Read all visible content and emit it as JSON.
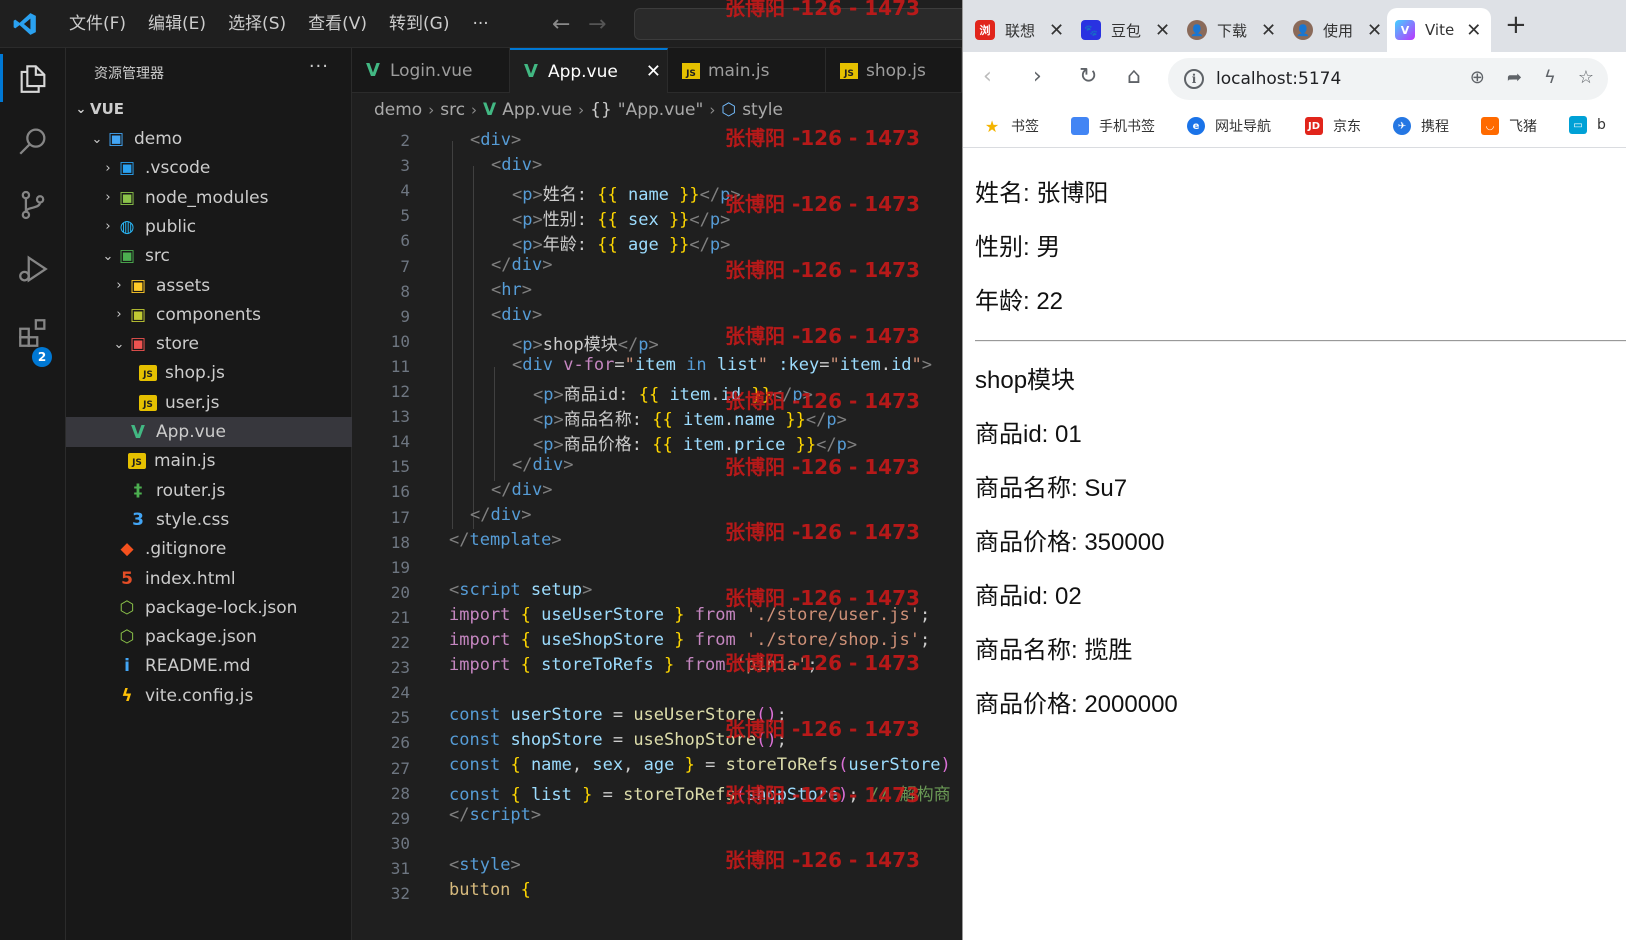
{
  "vscode": {
    "menus": [
      "文件(F)",
      "编辑(E)",
      "选择(S)",
      "查看(V)",
      "转到(G)"
    ],
    "menu_more": "···",
    "nav_back": "←",
    "nav_forward": "→",
    "badge_count": "2",
    "explorer": {
      "title": "资源管理器",
      "more": "···",
      "root": "VUE",
      "items": [
        {
          "label": "demo",
          "chev": "⌄",
          "icon": "folder-icon",
          "indent": 0
        },
        {
          "label": ".vscode",
          "chev": "›",
          "icon": "folder-vscode-icon",
          "indent": 1
        },
        {
          "label": "node_modules",
          "chev": "›",
          "icon": "folder-node-icon",
          "indent": 1
        },
        {
          "label": "public",
          "chev": "›",
          "icon": "folder-public-icon",
          "indent": 1
        },
        {
          "label": "src",
          "chev": "⌄",
          "icon": "folder-src-icon",
          "indent": 1
        },
        {
          "label": "assets",
          "chev": "›",
          "icon": "folder-assets-icon",
          "indent": 2
        },
        {
          "label": "components",
          "chev": "›",
          "icon": "folder-components-icon",
          "indent": 2
        },
        {
          "label": "store",
          "chev": "⌄",
          "icon": "folder-store-icon",
          "indent": 2
        },
        {
          "label": "shop.js",
          "chev": "",
          "icon": "js-file-icon",
          "indent": 3
        },
        {
          "label": "user.js",
          "chev": "",
          "icon": "js-file-icon",
          "indent": 3
        },
        {
          "label": "App.vue",
          "chev": "",
          "icon": "vue-file-icon",
          "indent": 2,
          "selected": true
        },
        {
          "label": "main.js",
          "chev": "",
          "icon": "js-file-icon",
          "indent": 2
        },
        {
          "label": "router.js",
          "chev": "",
          "icon": "router-file-icon",
          "indent": 2
        },
        {
          "label": "style.css",
          "chev": "",
          "icon": "css-file-icon",
          "indent": 2
        },
        {
          "label": ".gitignore",
          "chev": "",
          "icon": "git-file-icon",
          "indent": 1
        },
        {
          "label": "index.html",
          "chev": "",
          "icon": "html-file-icon",
          "indent": 1
        },
        {
          "label": "package-lock.json",
          "chev": "",
          "icon": "node-json-icon",
          "indent": 1
        },
        {
          "label": "package.json",
          "chev": "",
          "icon": "node-json-icon",
          "indent": 1
        },
        {
          "label": "README.md",
          "chev": "",
          "icon": "info-file-icon",
          "indent": 1
        },
        {
          "label": "vite.config.js",
          "chev": "",
          "icon": "vite-file-icon",
          "indent": 1
        }
      ]
    },
    "tabs": [
      {
        "label": "Login.vue",
        "type": "vue",
        "active": false
      },
      {
        "label": "App.vue",
        "type": "vue",
        "active": true,
        "close": "✕"
      },
      {
        "label": "main.js",
        "type": "js",
        "active": false
      },
      {
        "label": "shop.js",
        "type": "js",
        "active": false
      }
    ],
    "breadcrumb": {
      "a": "demo",
      "b": "src",
      "c": "App.vue",
      "d": "\"App.vue\"",
      "e": "style",
      "sep": "›",
      "braces": "{}"
    },
    "line_numbers": [
      "2",
      "3",
      "4",
      "5",
      "6",
      "7",
      "8",
      "9",
      "10",
      "11",
      "12",
      "13",
      "14",
      "15",
      "16",
      "17",
      "18",
      "19",
      "20",
      "21",
      "22",
      "23",
      "24",
      "25",
      "26",
      "27",
      "28",
      "29",
      "30",
      "31",
      "32"
    ],
    "watermark": "张博阳 -126 - 1473"
  },
  "browser": {
    "tabs": [
      {
        "label": "联想",
        "fav_text": "浏"
      },
      {
        "label": "豆包",
        "fav_text": "🐾"
      },
      {
        "label": "下载",
        "fav_text": "👤"
      },
      {
        "label": "使用",
        "fav_text": "👤"
      },
      {
        "label": "Vite",
        "fav_text": "V",
        "active": true
      }
    ],
    "tab_close": "✕",
    "new_tab": "+",
    "address": "localhost:5174",
    "bookmarks": [
      {
        "label": "书签",
        "color": "#f4b400"
      },
      {
        "label": "手机书签",
        "color": "#4285f4"
      },
      {
        "label": "网址导航",
        "color": "#1a73e8"
      },
      {
        "label": "京东",
        "color": "#e1251b"
      },
      {
        "label": "携程",
        "color": "#2577e3"
      },
      {
        "label": "飞猪",
        "color": "#ff6a00"
      },
      {
        "label": "b",
        "color": "#00a1d6"
      }
    ],
    "page": {
      "name": "姓名: 张博阳",
      "sex": "性别: 男",
      "age": "年龄: 22",
      "shop_title": "shop模块",
      "items": [
        {
          "id": "商品id: 01",
          "name": "商品名称: Su7",
          "price": "商品价格: 350000"
        },
        {
          "id": "商品id: 02",
          "name": "商品名称: 揽胜",
          "price": "商品价格: 2000000"
        }
      ]
    }
  }
}
